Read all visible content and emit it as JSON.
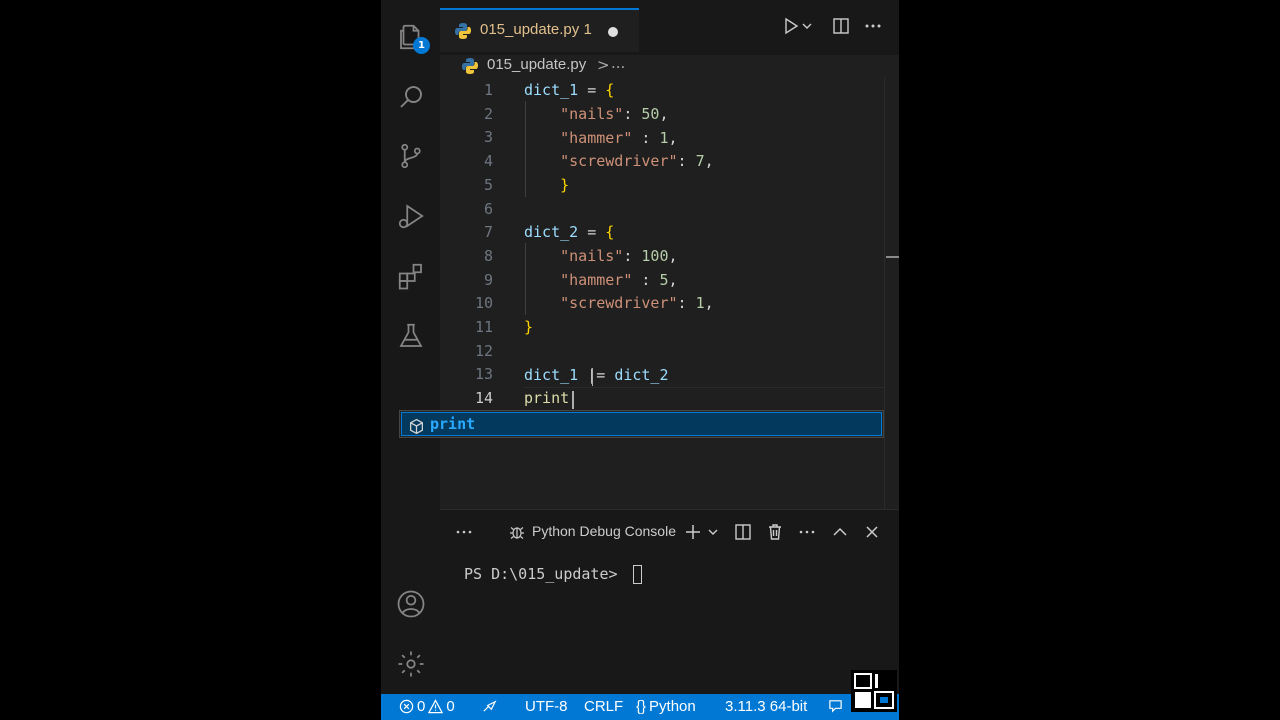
{
  "activity_bar": {
    "explorer_badge": "1"
  },
  "tab": {
    "name": "015_update.py",
    "problems": "1"
  },
  "breadcrumb": {
    "file": "015_update.py",
    "separator": ">",
    "more": "..."
  },
  "editor": {
    "active_line": 14,
    "lines": [
      {
        "no": "1"
      },
      {
        "no": "2"
      },
      {
        "no": "3"
      },
      {
        "no": "4"
      },
      {
        "no": "5"
      },
      {
        "no": "6"
      },
      {
        "no": "7"
      },
      {
        "no": "8"
      },
      {
        "no": "9"
      },
      {
        "no": "10"
      },
      {
        "no": "11"
      },
      {
        "no": "12"
      },
      {
        "no": "13"
      },
      {
        "no": "14"
      }
    ],
    "code": {
      "l1_var": "dict_1",
      "l1_op": " = ",
      "l1_br": "{",
      "l2_key": "\"nails\"",
      "l2_sep": ": ",
      "l2_val": "50",
      "l2_end": ",",
      "l3_key": "\"hammer\"",
      "l3_sep": " : ",
      "l3_val": "1",
      "l3_end": ",",
      "l4_key": "\"screwdriver\"",
      "l4_sep": ": ",
      "l4_val": "7",
      "l4_end": ",",
      "l5_br": "}",
      "l7_var": "dict_2",
      "l7_op": " = ",
      "l7_br": "{",
      "l8_key": "\"nails\"",
      "l8_sep": ": ",
      "l8_val": "100",
      "l8_end": ",",
      "l9_key": "\"hammer\"",
      "l9_sep": " : ",
      "l9_val": "5",
      "l9_end": ",",
      "l10_key": "\"screwdriver\"",
      "l10_sep": ": ",
      "l10_val": "1",
      "l10_end": ",",
      "l11_br": "}",
      "l13_var1": "dict_1",
      "l13_op": " |= ",
      "l13_var2": "dict_2",
      "l14_text": "print"
    }
  },
  "suggest": {
    "label": "print"
  },
  "panel": {
    "title": "Python Debug Console",
    "prompt": "PS D:\\015_update> "
  },
  "status_bar": {
    "errors": "0",
    "warnings": "0",
    "encoding": "UTF-8",
    "eol": "CRLF",
    "language_brace": "{}",
    "language": "Python",
    "interpreter": "3.11.3 64-bit"
  },
  "colors": {
    "accent": "#0078d4",
    "background": "#1f1f1f",
    "status": "#0078d4"
  }
}
